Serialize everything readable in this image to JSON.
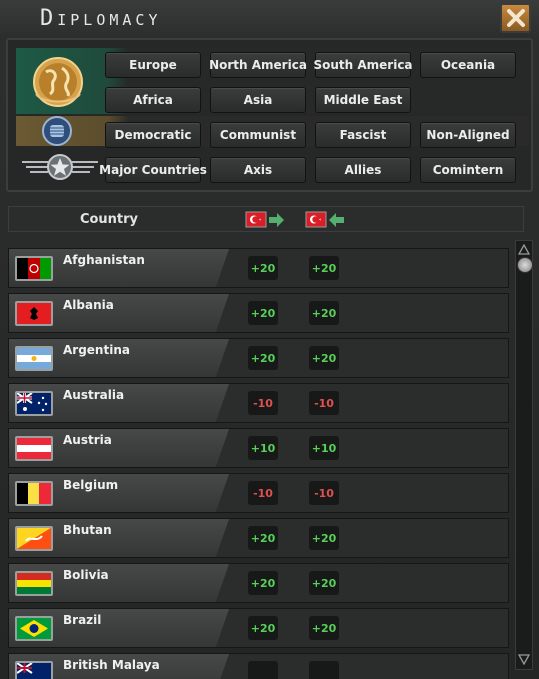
{
  "window": {
    "title": "Diplomacy"
  },
  "filters": {
    "regions": [
      "Europe",
      "North America",
      "South America",
      "Oceania",
      "Africa",
      "Asia",
      "Middle East"
    ],
    "ideologies": [
      "Democratic",
      "Communist",
      "Fascist",
      "Non-Aligned"
    ],
    "factions": [
      "Major Countries",
      "Axis",
      "Allies",
      "Comintern"
    ]
  },
  "header": {
    "country_label": "Country"
  },
  "countries": [
    {
      "name": "Afghanistan",
      "out": "+20",
      "in": "+20",
      "flag": "afghanistan-flag",
      "sign": "pos"
    },
    {
      "name": "Albania",
      "out": "+20",
      "in": "+20",
      "flag": "albania-flag",
      "sign": "pos"
    },
    {
      "name": "Argentina",
      "out": "+20",
      "in": "+20",
      "flag": "argentina-flag",
      "sign": "pos"
    },
    {
      "name": "Australia",
      "out": "-10",
      "in": "-10",
      "flag": "australia-flag",
      "sign": "neg"
    },
    {
      "name": "Austria",
      "out": "+10",
      "in": "+10",
      "flag": "austria-flag",
      "sign": "pos"
    },
    {
      "name": "Belgium",
      "out": "-10",
      "in": "-10",
      "flag": "belgium-flag",
      "sign": "neg"
    },
    {
      "name": "Bhutan",
      "out": "+20",
      "in": "+20",
      "flag": "bhutan-flag",
      "sign": "pos"
    },
    {
      "name": "Bolivia",
      "out": "+20",
      "in": "+20",
      "flag": "bolivia-flag",
      "sign": "pos"
    },
    {
      "name": "Brazil",
      "out": "+20",
      "in": "+20",
      "flag": "brazil-flag",
      "sign": "pos"
    },
    {
      "name": "British Malaya",
      "out": "",
      "in": "",
      "flag": "british-malaya-flag",
      "sign": "pos"
    }
  ],
  "colors": {
    "positive": "#58d058",
    "negative": "#e05050",
    "accent": "#c78a3e"
  }
}
